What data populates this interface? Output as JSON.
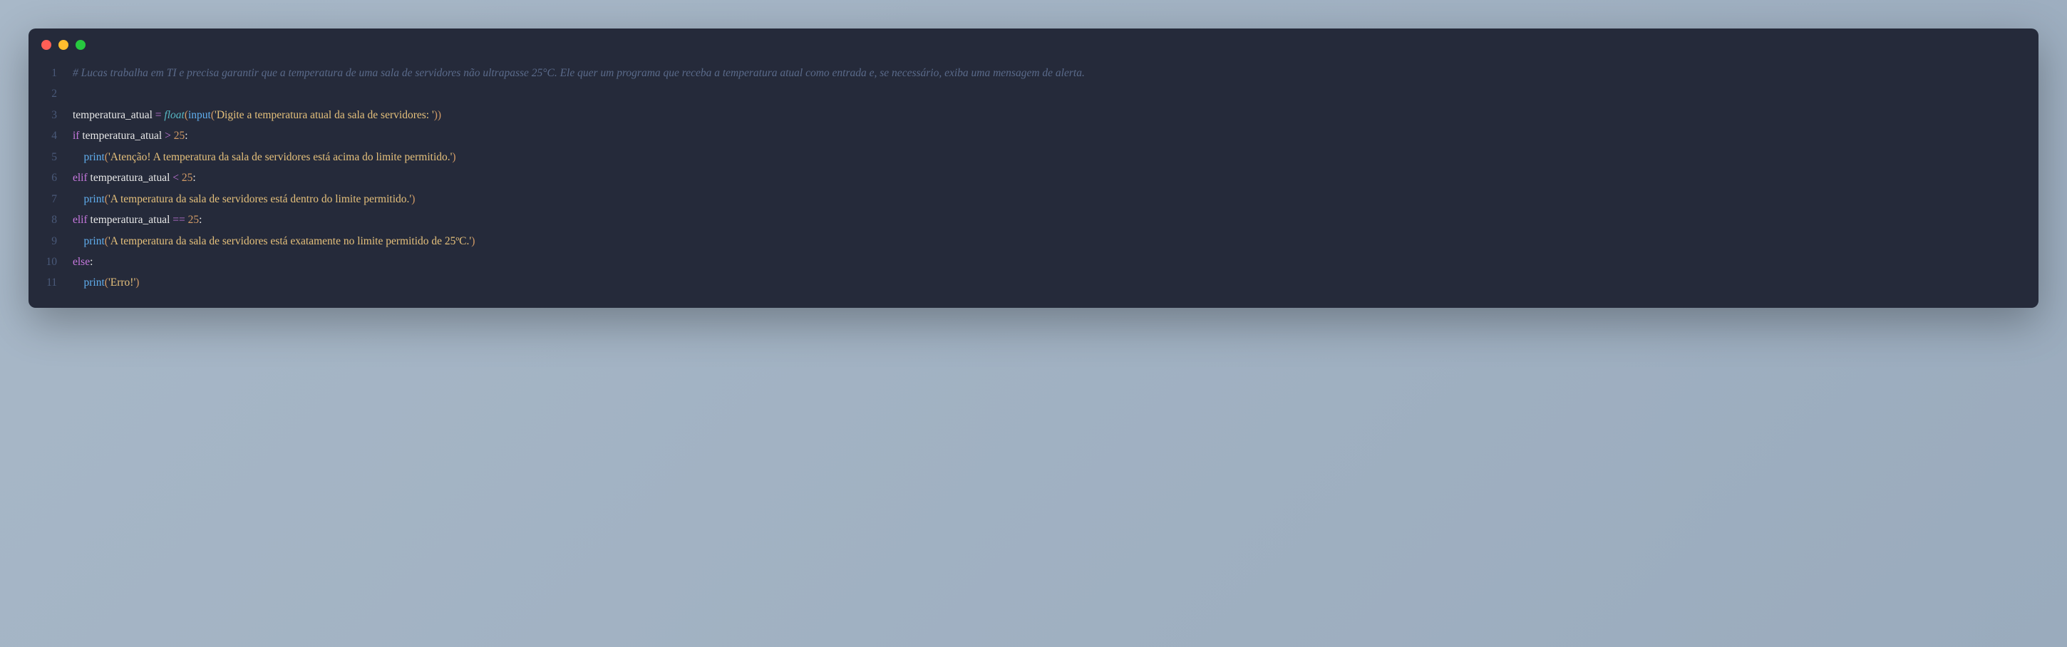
{
  "window": {
    "controls": [
      "close",
      "minimize",
      "maximize"
    ]
  },
  "code": {
    "lines": [
      {
        "num": "1",
        "tokens": [
          {
            "cls": "comment",
            "t": "# Lucas trabalha em TI e precisa garantir que a temperatura de uma sala de servidores não ultrapasse 25°C. Ele quer um programa que receba a temperatura atual como entrada e, se necessário, exiba uma mensagem de alerta."
          }
        ]
      },
      {
        "num": "2",
        "tokens": []
      },
      {
        "num": "3",
        "tokens": [
          {
            "cls": "ident",
            "t": "temperatura_atual "
          },
          {
            "cls": "op",
            "t": "="
          },
          {
            "cls": "ident",
            "t": " "
          },
          {
            "cls": "builtin",
            "t": "float"
          },
          {
            "cls": "paren",
            "t": "("
          },
          {
            "cls": "call",
            "t": "input"
          },
          {
            "cls": "paren",
            "t": "("
          },
          {
            "cls": "string",
            "t": "'Digite a temperatura atual da sala de servidores: '"
          },
          {
            "cls": "paren",
            "t": "))"
          }
        ]
      },
      {
        "num": "4",
        "tokens": [
          {
            "cls": "kw",
            "t": "if"
          },
          {
            "cls": "ident",
            "t": " temperatura_atual "
          },
          {
            "cls": "op",
            "t": ">"
          },
          {
            "cls": "ident",
            "t": " "
          },
          {
            "cls": "num",
            "t": "25"
          },
          {
            "cls": "ident",
            "t": ":"
          }
        ]
      },
      {
        "num": "5",
        "tokens": [
          {
            "cls": "ident",
            "t": "    "
          },
          {
            "cls": "call",
            "t": "print"
          },
          {
            "cls": "paren",
            "t": "("
          },
          {
            "cls": "string",
            "t": "'Atenção! A temperatura da sala de servidores está acima do limite permitido.'"
          },
          {
            "cls": "paren",
            "t": ")"
          }
        ]
      },
      {
        "num": "6",
        "tokens": [
          {
            "cls": "kw",
            "t": "elif"
          },
          {
            "cls": "ident",
            "t": " temperatura_atual "
          },
          {
            "cls": "op",
            "t": "<"
          },
          {
            "cls": "ident",
            "t": " "
          },
          {
            "cls": "num",
            "t": "25"
          },
          {
            "cls": "ident",
            "t": ":"
          }
        ]
      },
      {
        "num": "7",
        "tokens": [
          {
            "cls": "ident",
            "t": "    "
          },
          {
            "cls": "call",
            "t": "print"
          },
          {
            "cls": "paren",
            "t": "("
          },
          {
            "cls": "string",
            "t": "'A temperatura da sala de servidores está dentro do limite permitido.'"
          },
          {
            "cls": "paren",
            "t": ")"
          }
        ]
      },
      {
        "num": "8",
        "tokens": [
          {
            "cls": "kw",
            "t": "elif"
          },
          {
            "cls": "ident",
            "t": " temperatura_atual "
          },
          {
            "cls": "op",
            "t": "=="
          },
          {
            "cls": "ident",
            "t": " "
          },
          {
            "cls": "num",
            "t": "25"
          },
          {
            "cls": "ident",
            "t": ":"
          }
        ]
      },
      {
        "num": "9",
        "tokens": [
          {
            "cls": "ident",
            "t": "    "
          },
          {
            "cls": "call",
            "t": "print"
          },
          {
            "cls": "paren",
            "t": "("
          },
          {
            "cls": "string",
            "t": "'A temperatura da sala de servidores está exatamente no limite permitido de 25ºC.'"
          },
          {
            "cls": "paren",
            "t": ")"
          }
        ]
      },
      {
        "num": "10",
        "tokens": [
          {
            "cls": "kw",
            "t": "else"
          },
          {
            "cls": "ident",
            "t": ":"
          }
        ]
      },
      {
        "num": "11",
        "tokens": [
          {
            "cls": "ident",
            "t": "    "
          },
          {
            "cls": "call",
            "t": "print"
          },
          {
            "cls": "paren",
            "t": "("
          },
          {
            "cls": "string",
            "t": "'Erro!'"
          },
          {
            "cls": "paren",
            "t": ")"
          }
        ]
      }
    ]
  }
}
